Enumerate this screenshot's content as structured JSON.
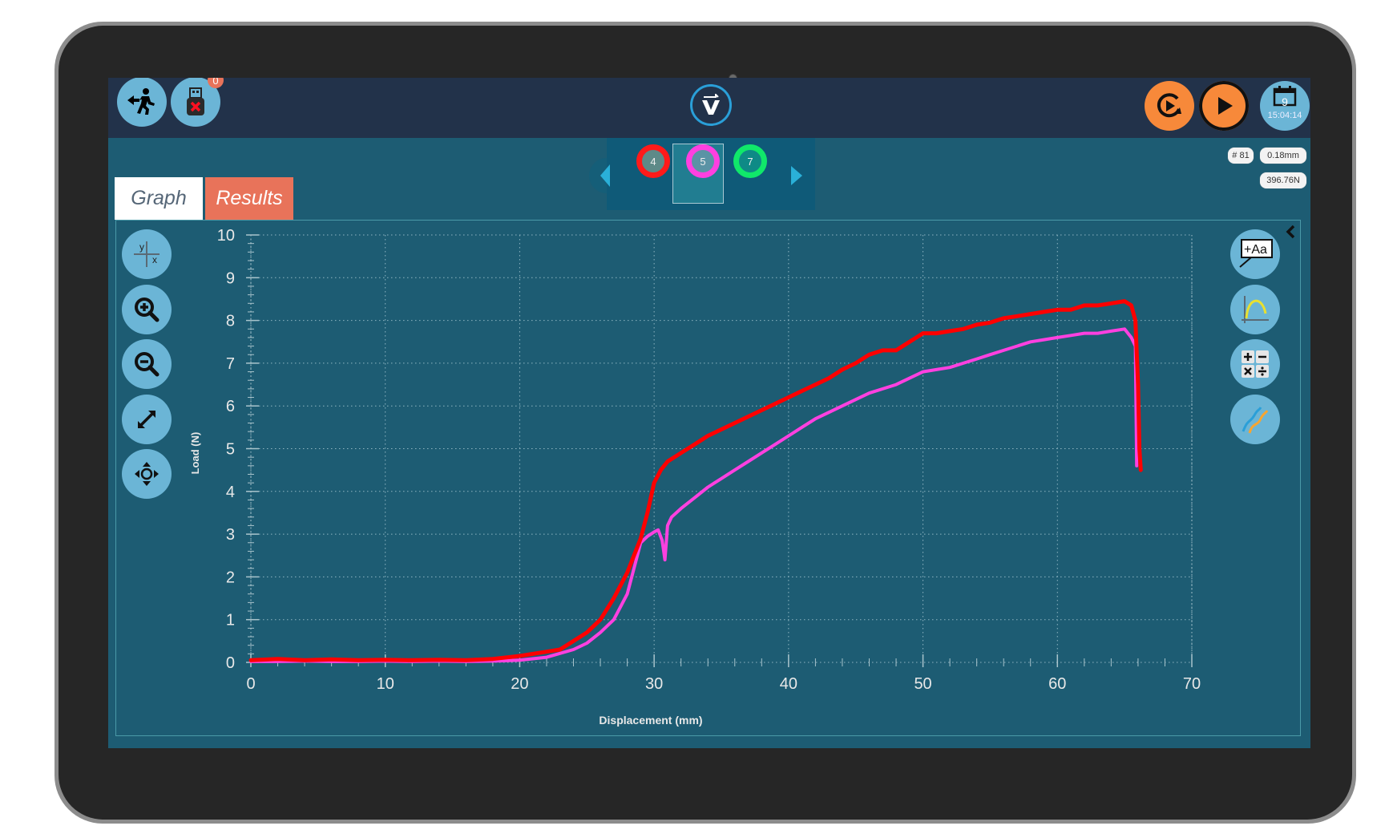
{
  "topbar": {
    "exit_icon": "running-exit-icon",
    "usb_icon": "usb-disconnected-icon",
    "usb_badge": "0",
    "logo_icon": "v-logo-icon",
    "restart_icon": "replay-icon",
    "play_icon": "play-icon",
    "calendar_icon": "calendar-icon",
    "date_day": "9",
    "time": "15:04:14"
  },
  "specimens": {
    "items": [
      {
        "label": "4",
        "ring_color": "#ff1a1a",
        "fill": "#5e8a88"
      },
      {
        "label": "5",
        "ring_color": "#ff40e0",
        "fill": "#5b93a5"
      },
      {
        "label": "7",
        "ring_color": "#10e86a",
        "fill": "#0e8a86"
      }
    ],
    "selected": "5",
    "prev_icon": "chevron-left-icon",
    "next_icon": "chevron-right-icon"
  },
  "readouts": {
    "test_number": "# 81",
    "displacement": "0.18mm",
    "load": "396.76N"
  },
  "tabs": [
    {
      "label": "Graph",
      "active": true
    },
    {
      "label": "Results",
      "active": false
    }
  ],
  "left_tools": [
    {
      "name": "axes-toggle-icon"
    },
    {
      "name": "zoom-in-icon"
    },
    {
      "name": "zoom-out-icon"
    },
    {
      "name": "expand-icon"
    },
    {
      "name": "pan-icon"
    }
  ],
  "right_tools": [
    {
      "name": "add-annotation-icon",
      "label": "+Aa"
    },
    {
      "name": "peak-curve-icon"
    },
    {
      "name": "calculator-icon"
    },
    {
      "name": "overlay-curves-icon"
    }
  ],
  "colors": {
    "screen_bg": "#1d5c73",
    "topbar_bg": "#22324a",
    "tool_button": "#6bb5d6",
    "accent_orange": "#f7893a",
    "results_tab": "#e8735a",
    "series_4": "#ff0000",
    "series_5": "#ff40e0"
  },
  "chart_data": {
    "type": "line",
    "title": "",
    "xlabel": "Displacement (mm)",
    "ylabel": "Load (N)",
    "xlim": [
      0,
      70
    ],
    "ylim": [
      0,
      10
    ],
    "xticks": [
      "0",
      "10",
      "20",
      "30",
      "40",
      "50",
      "60",
      "70"
    ],
    "yticks": [
      "0",
      "1",
      "2",
      "3",
      "4",
      "5",
      "6",
      "7",
      "8",
      "9",
      "10"
    ],
    "grid": true,
    "legend": "none",
    "series": [
      {
        "name": "Specimen 4",
        "color": "#ff0000",
        "x": [
          0,
          2,
          4,
          6,
          8,
          10,
          12,
          14,
          16,
          18,
          20,
          22,
          23,
          24,
          25,
          26,
          27,
          28,
          29,
          29.5,
          30,
          30.5,
          31,
          32,
          33,
          34,
          35,
          36,
          37,
          38,
          39,
          40,
          41,
          42,
          43,
          44,
          45,
          46,
          47,
          48,
          49,
          50,
          51,
          52,
          53,
          54,
          55,
          56,
          57,
          58,
          59,
          60,
          61,
          62,
          63,
          64,
          65,
          65.5,
          65.8,
          66.0,
          66.1,
          66.2
        ],
        "y": [
          0.05,
          0.08,
          0.05,
          0.07,
          0.05,
          0.06,
          0.05,
          0.06,
          0.05,
          0.08,
          0.15,
          0.25,
          0.3,
          0.5,
          0.7,
          1.0,
          1.5,
          2.1,
          2.9,
          3.5,
          4.2,
          4.5,
          4.7,
          4.9,
          5.1,
          5.3,
          5.45,
          5.6,
          5.75,
          5.9,
          6.05,
          6.2,
          6.35,
          6.5,
          6.65,
          6.85,
          7.0,
          7.2,
          7.3,
          7.3,
          7.5,
          7.7,
          7.7,
          7.75,
          7.8,
          7.9,
          7.95,
          8.05,
          8.1,
          8.15,
          8.2,
          8.25,
          8.25,
          8.35,
          8.35,
          8.4,
          8.45,
          8.35,
          8.0,
          6.5,
          5.0,
          4.5
        ]
      },
      {
        "name": "Specimen 5",
        "color": "#ff40e0",
        "x": [
          0,
          2,
          4,
          6,
          8,
          10,
          12,
          14,
          16,
          18,
          20,
          22,
          24,
          25,
          26,
          27,
          28,
          28.5,
          29,
          29.5,
          30,
          30.3,
          30.6,
          30.8,
          31.0,
          31.3,
          32,
          33,
          34,
          35,
          36,
          37,
          38,
          39,
          40,
          41,
          42,
          43,
          44,
          45,
          46,
          47,
          48,
          49,
          50,
          51,
          52,
          53,
          54,
          55,
          56,
          57,
          58,
          59,
          60,
          61,
          62,
          63,
          64,
          65,
          65.5,
          65.8,
          65.9
        ],
        "y": [
          0.02,
          0.02,
          0.03,
          0.02,
          0.02,
          0.03,
          0.02,
          0.03,
          0.02,
          0.03,
          0.05,
          0.12,
          0.3,
          0.45,
          0.7,
          1.0,
          1.6,
          2.2,
          2.8,
          2.95,
          3.05,
          3.1,
          2.85,
          2.4,
          3.2,
          3.4,
          3.6,
          3.85,
          4.1,
          4.3,
          4.5,
          4.7,
          4.9,
          5.1,
          5.3,
          5.5,
          5.7,
          5.85,
          6.0,
          6.15,
          6.3,
          6.4,
          6.5,
          6.65,
          6.8,
          6.85,
          6.9,
          7.0,
          7.1,
          7.2,
          7.3,
          7.4,
          7.5,
          7.55,
          7.6,
          7.65,
          7.7,
          7.7,
          7.75,
          7.8,
          7.6,
          7.4,
          4.6
        ]
      }
    ]
  }
}
